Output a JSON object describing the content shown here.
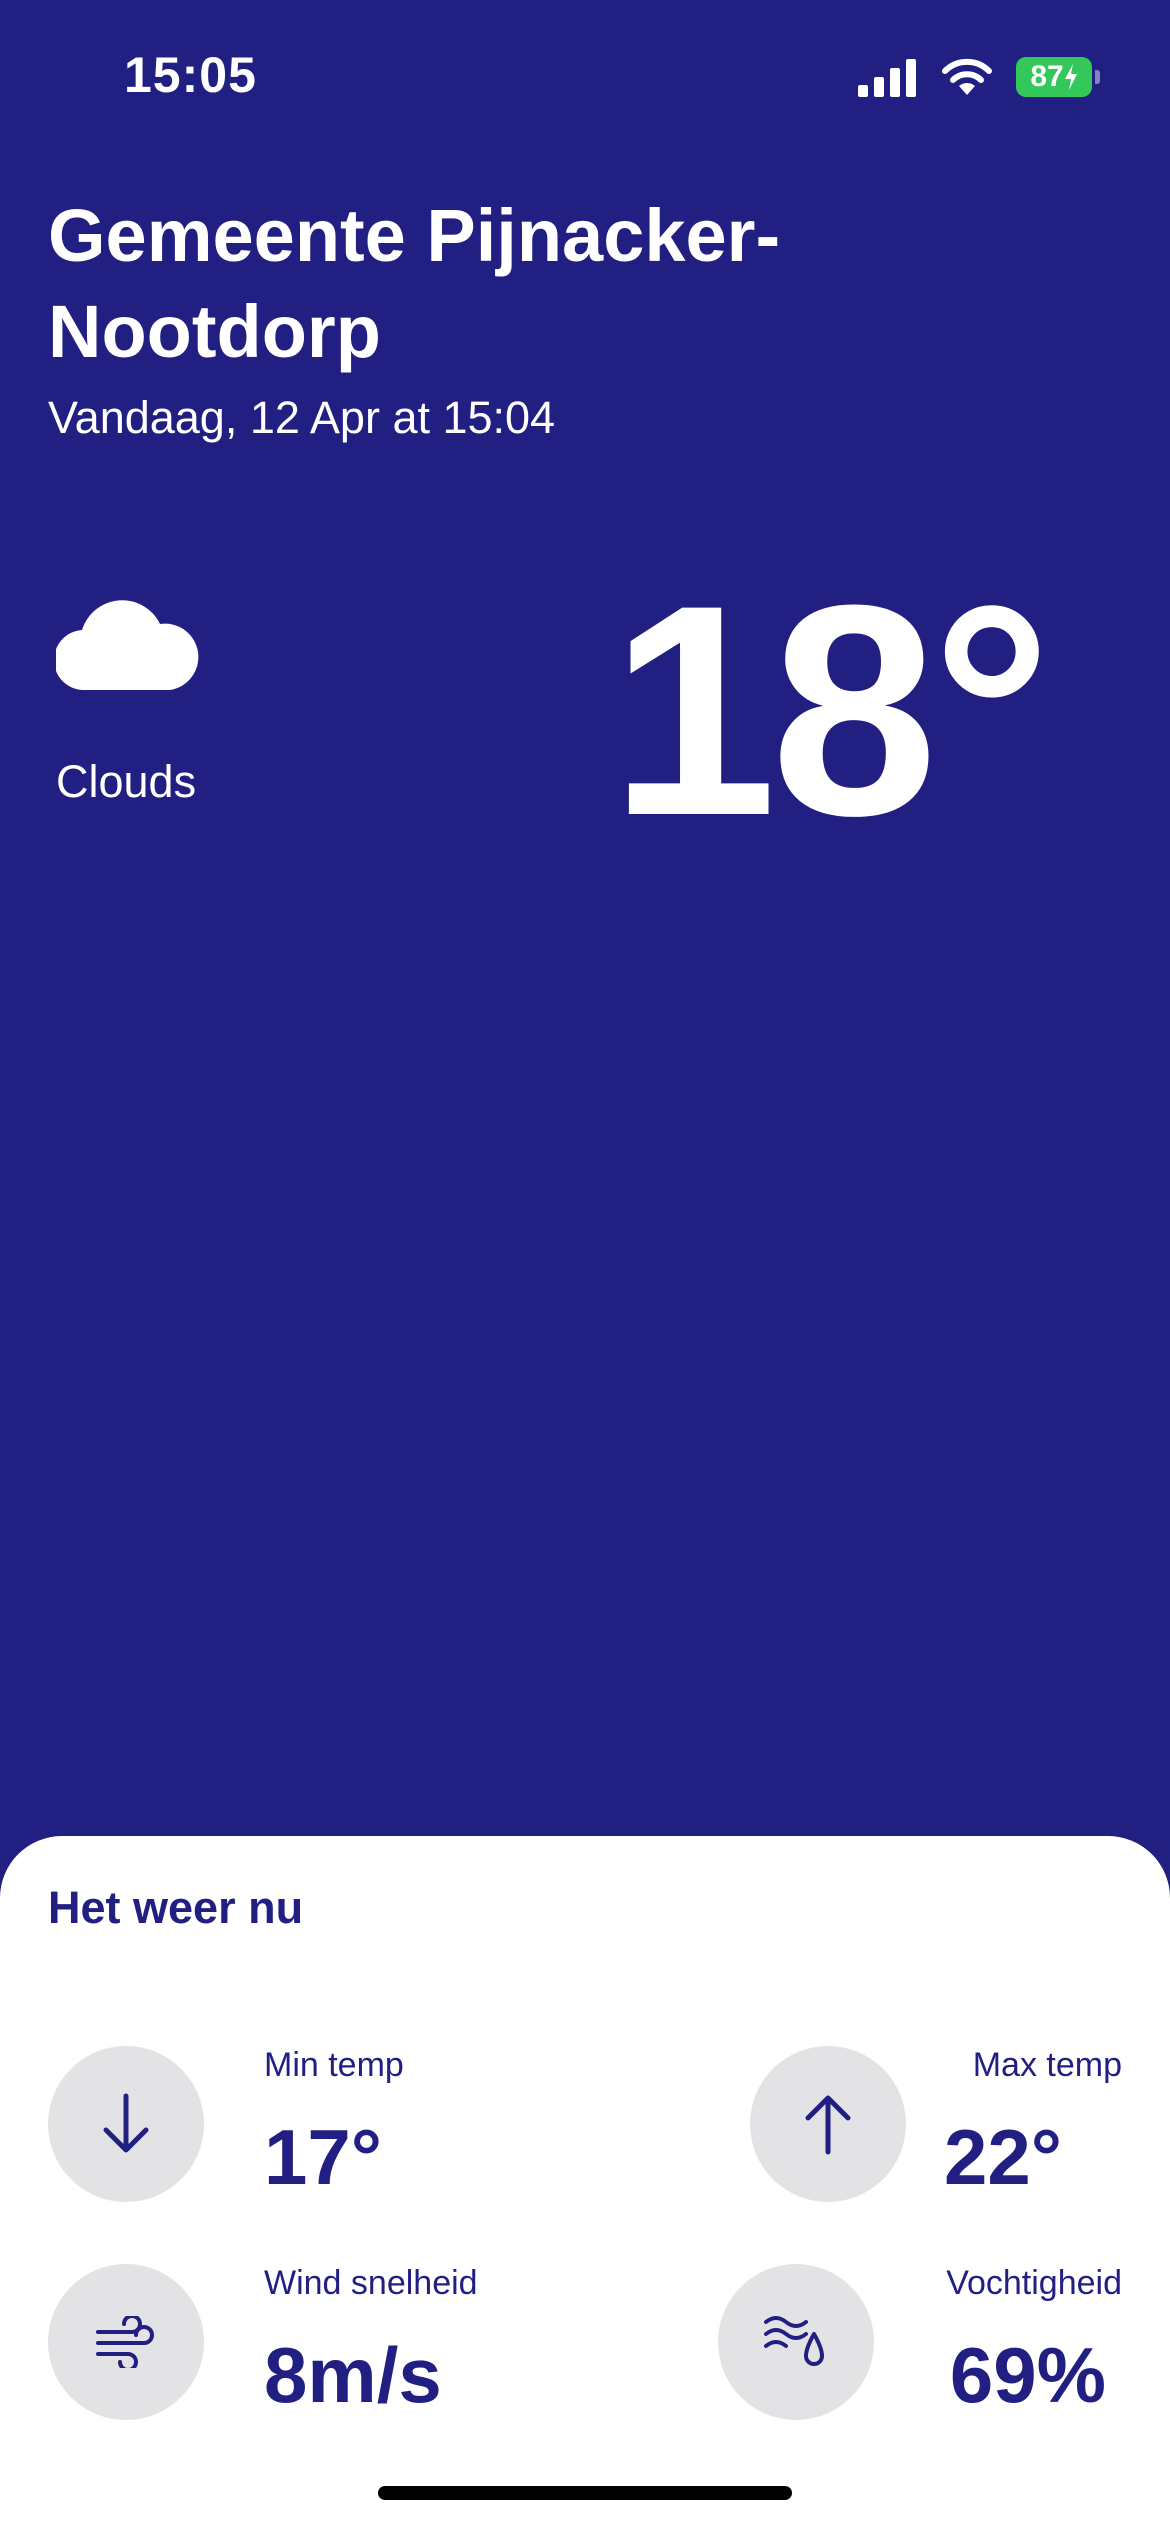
{
  "status_bar": {
    "time": "15:05",
    "battery": "87",
    "battery_color": "#34c759"
  },
  "header": {
    "location": "Gemeente Pijnacker-Nootdorp",
    "timestamp": "Vandaag, 12 Apr at 15:04"
  },
  "current": {
    "condition": "Clouds",
    "condition_icon": "cloud-icon",
    "temperature": "18°"
  },
  "details": {
    "title": "Het weer nu",
    "items": [
      {
        "label": "Min temp",
        "value": "17°",
        "icon": "arrow-down-icon"
      },
      {
        "label": "Max temp",
        "value": "22°",
        "icon": "arrow-up-icon"
      },
      {
        "label": "Wind snelheid",
        "value": "8m/s",
        "icon": "wind-icon"
      },
      {
        "label": "Vochtigheid",
        "value": "69%",
        "icon": "humidity-icon"
      }
    ]
  },
  "colors": {
    "background": "#221f83",
    "sheet": "#ffffff",
    "icon_circle": "#e3e3e6"
  }
}
